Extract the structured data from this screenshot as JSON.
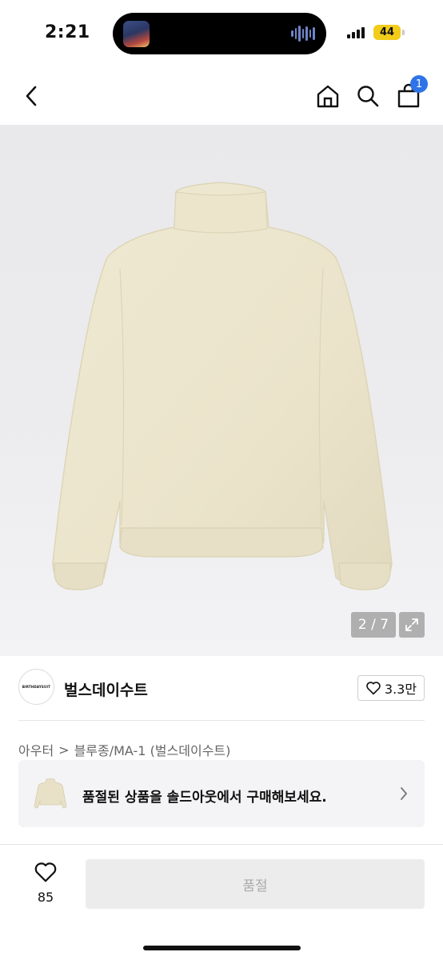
{
  "status_bar": {
    "time": "2:21",
    "battery": "44"
  },
  "nav": {
    "cart_count": "1"
  },
  "gallery": {
    "counter": "2 / 7",
    "current": 2,
    "total": 7
  },
  "shop": {
    "logo_text": "BIRTHDAYSUIT",
    "name": "벌스데이수트",
    "likes": "3.3만"
  },
  "breadcrumb": {
    "category": "아우터",
    "separator": ">",
    "subcategory": "블루종/MA-1 (벌스데이수트)"
  },
  "soldout_banner": {
    "text": "품절된 상품을 솔드아웃에서 구매해보세요."
  },
  "bottom": {
    "wish_count": "85",
    "buy_label": "품절"
  },
  "colors": {
    "accent": "#2e74e8",
    "battery": "#f2cc1a",
    "jacket": "#ece6cf",
    "disabled_bg": "#ececec",
    "disabled_text": "#aaaaaa"
  },
  "icons": [
    "back-icon",
    "home-icon",
    "search-icon",
    "cart-icon",
    "expand-icon",
    "heart-icon",
    "chevron-right-icon"
  ]
}
